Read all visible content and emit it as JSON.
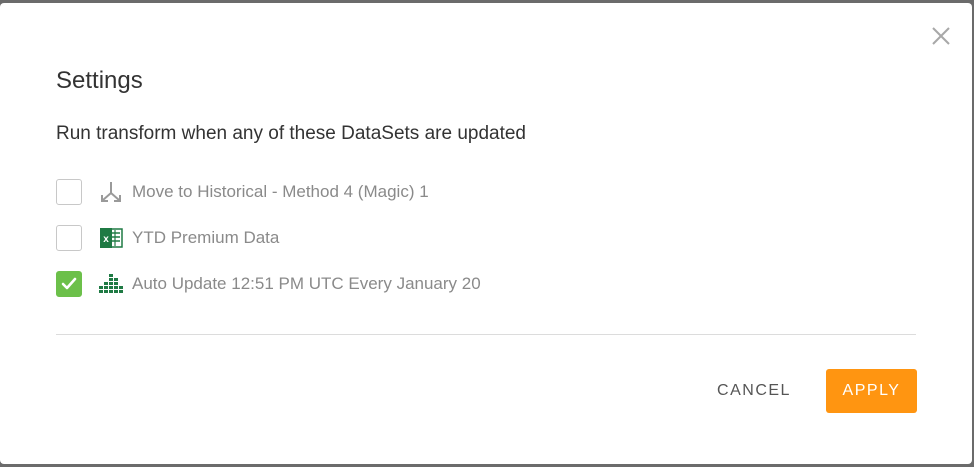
{
  "dialog": {
    "title": "Settings",
    "subtitle": "Run transform when any of these DataSets are updated",
    "close_icon": "close-icon"
  },
  "datasets": [
    {
      "label": "Move to Historical - Method 4 (Magic) 1",
      "checked": false,
      "icon": "dataflow-merge-icon"
    },
    {
      "label": "YTD Premium Data",
      "checked": false,
      "icon": "excel-icon"
    },
    {
      "label": "Auto Update 12:51 PM UTC Every January 20",
      "checked": true,
      "icon": "dataset-bars-icon"
    }
  ],
  "buttons": {
    "cancel_label": "CANCEL",
    "apply_label": "APPLY"
  },
  "colors": {
    "accent": "#ff9511",
    "check": "#6cc04a",
    "excel_green": "#1f7a44"
  }
}
